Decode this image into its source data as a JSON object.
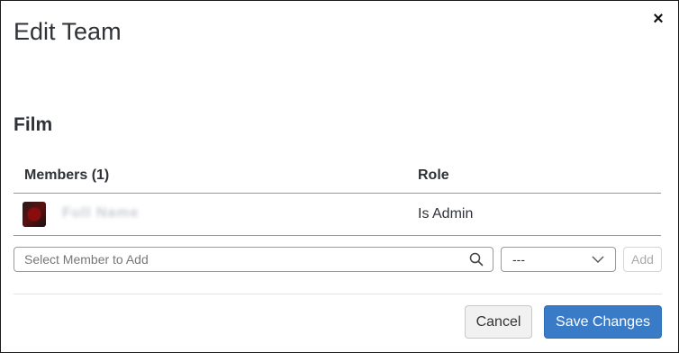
{
  "modal": {
    "title": "Edit Team",
    "close_icon": "close-icon",
    "close_symbol": "×"
  },
  "team": {
    "name": "Film"
  },
  "members_table": {
    "headers": {
      "members": "Members (1)",
      "role": "Role"
    },
    "rows": [
      {
        "avatar": "avatar-image",
        "name": "Full Name",
        "role": "Is Admin"
      }
    ]
  },
  "add_member": {
    "search_placeholder": "Select Member to Add",
    "search_icon": "search-icon",
    "role_select_value": "---",
    "role_select_icon": "chevron-down-icon",
    "add_label": "Add"
  },
  "footer": {
    "cancel_label": "Cancel",
    "save_label": "Save Changes"
  },
  "colors": {
    "primary_button": "#3a7bc8",
    "text": "#2f3236",
    "border": "#9a9a9a"
  }
}
